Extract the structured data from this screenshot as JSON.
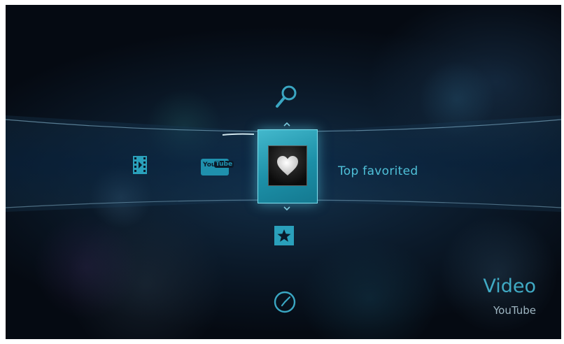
{
  "menu": {
    "selected_option": "Top favorited",
    "items": [
      {
        "icon": "film-icon",
        "label": ""
      },
      {
        "icon": "youtube-logo-icon",
        "label": ""
      },
      {
        "icon": "heart-icon",
        "label": "Top favorited"
      }
    ],
    "vertical_items": [
      {
        "icon": "search-icon"
      },
      {
        "icon": "heart-icon"
      },
      {
        "icon": "star-icon"
      },
      {
        "icon": "clock-icon"
      }
    ]
  },
  "section": {
    "title": "Video",
    "subtitle": "YouTube"
  },
  "youtube_logo": {
    "text_you": "You",
    "text_tube": "Tube"
  },
  "colors": {
    "accent": "#40aac4",
    "background": "#0b1a2a",
    "selected_tile": "#2aa2bb"
  }
}
